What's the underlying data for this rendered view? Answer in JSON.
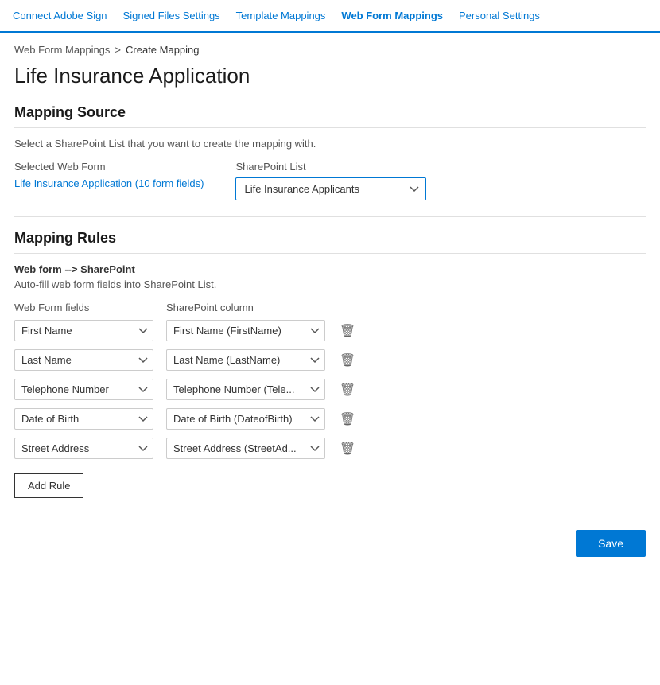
{
  "nav": {
    "items": [
      {
        "id": "connect-adobe-sign",
        "label": "Connect Adobe Sign",
        "active": false
      },
      {
        "id": "signed-files-settings",
        "label": "Signed Files Settings",
        "active": false
      },
      {
        "id": "template-mappings",
        "label": "Template Mappings",
        "active": false
      },
      {
        "id": "web-form-mappings",
        "label": "Web Form Mappings",
        "active": true
      },
      {
        "id": "personal-settings",
        "label": "Personal Settings",
        "active": false
      }
    ]
  },
  "breadcrumb": {
    "parent": "Web Form Mappings",
    "separator": ">",
    "current": "Create Mapping"
  },
  "page_title": "Life Insurance Application",
  "mapping_source": {
    "section_title": "Mapping Source",
    "description": "Select a SharePoint List that you want to create the mapping with.",
    "selected_web_form_label": "Selected Web Form",
    "selected_web_form_value": "Life Insurance Application (10 form fields)",
    "sharepoint_list_label": "SharePoint List",
    "sharepoint_list_selected": "Life Insurance Applicants",
    "sharepoint_list_options": [
      "Life Insurance Applicants"
    ]
  },
  "mapping_rules": {
    "section_title": "Mapping Rules",
    "subtitle": "Web form --> SharePoint",
    "description": "Auto-fill web form fields into SharePoint List.",
    "web_form_fields_header": "Web Form fields",
    "sharepoint_column_header": "SharePoint column",
    "rules": [
      {
        "id": "rule-1",
        "web_form_field": "First Name",
        "sharepoint_column": "First Name (FirstName)"
      },
      {
        "id": "rule-2",
        "web_form_field": "Last Name",
        "sharepoint_column": "Last Name (LastName)"
      },
      {
        "id": "rule-3",
        "web_form_field": "Telephone Number",
        "sharepoint_column": "Telephone Number (Tele..."
      },
      {
        "id": "rule-4",
        "web_form_field": "Date of Birth",
        "sharepoint_column": "Date of Birth (DateofBirth)"
      },
      {
        "id": "rule-5",
        "web_form_field": "Street Address",
        "sharepoint_column": "Street Address (StreetAd..."
      }
    ],
    "add_rule_label": "Add Rule",
    "web_form_options": [
      "First Name",
      "Last Name",
      "Telephone Number",
      "Date of Birth",
      "Street Address"
    ],
    "sharepoint_column_options_1": [
      "First Name (FirstName)"
    ],
    "sharepoint_column_options_2": [
      "Last Name (LastName)"
    ],
    "sharepoint_column_options_3": [
      "Telephone Number (Tele..."
    ],
    "sharepoint_column_options_4": [
      "Date of Birth (DateofBirth)"
    ],
    "sharepoint_column_options_5": [
      "Street Address (StreetAd..."
    ]
  },
  "footer": {
    "save_label": "Save"
  },
  "icons": {
    "trash": "🗑",
    "chevron_down": "▾"
  }
}
